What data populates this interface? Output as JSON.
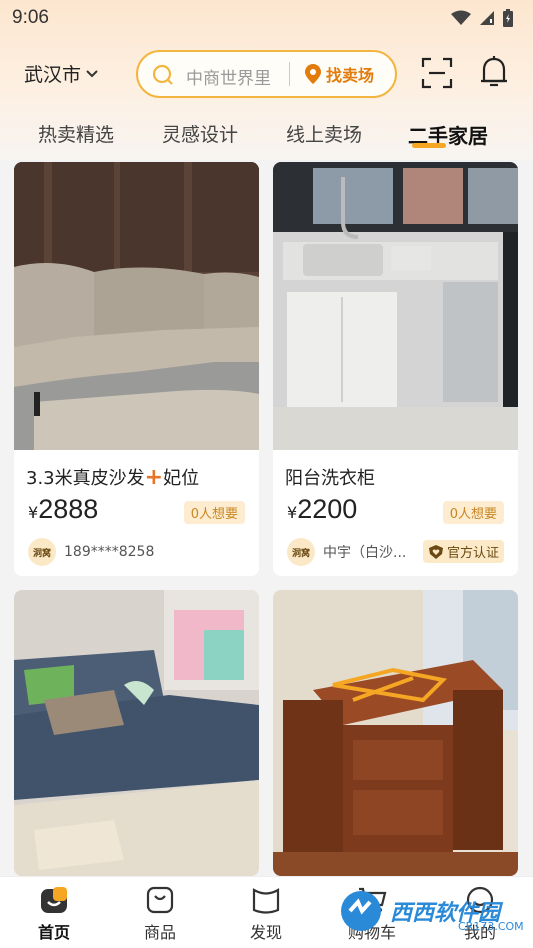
{
  "status": {
    "time": "9:06"
  },
  "header": {
    "city": "武汉市",
    "search_placeholder": "中商世界里",
    "find_market": "找卖场"
  },
  "tabs": [
    "热卖精选",
    "灵感设计",
    "线上卖场",
    "二手家居"
  ],
  "active_tab": "二手家居",
  "cards": [
    {
      "title": "3.3米真皮沙发",
      "title_plus": "+",
      "title_suffix": "妃位",
      "currency": "¥",
      "price": "2888",
      "want": "0人想要",
      "seller_logo": "洞窝",
      "seller": "189****8258",
      "certified": ""
    },
    {
      "title": "阳台洗衣柜",
      "title_plus": "",
      "title_suffix": "",
      "currency": "¥",
      "price": "2200",
      "want": "0人想要",
      "seller_logo": "洞窝",
      "seller": "中宇（白沙...",
      "certified": "官方认证"
    }
  ],
  "nav": {
    "home": "首页",
    "products": "商品",
    "discover": "发现",
    "cart": "购物车",
    "mine": "我的"
  },
  "watermark": {
    "brand": "西西软件园",
    "url": "CR173.COM"
  },
  "colors": {
    "accent": "#f5a623",
    "brand_orange": "#e27c0c",
    "bg": "#f3f3f4"
  }
}
